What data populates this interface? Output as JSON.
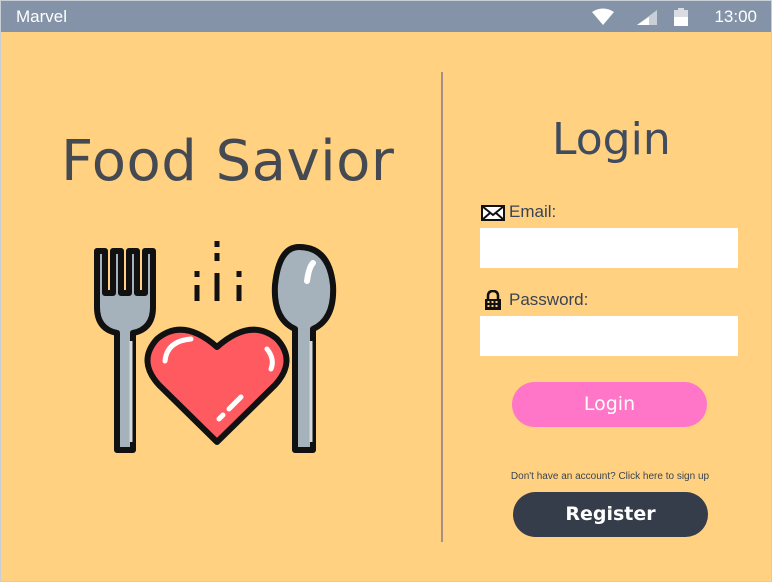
{
  "status_bar": {
    "app_name": "Marvel",
    "time": "13:00",
    "icons": [
      "wifi-icon",
      "signal-icon",
      "battery-icon"
    ]
  },
  "brand": {
    "title": "Food Savior",
    "logo_icon": "fork-heart-spoon-icon"
  },
  "login": {
    "heading": "Login",
    "email_label": "Email:",
    "email_icon": "envelope-icon",
    "email_value": "",
    "email_placeholder": "",
    "password_label": "Password:",
    "password_icon": "lock-icon",
    "password_value": "",
    "password_placeholder": "",
    "login_button": "Login",
    "signup_hint": "Don't have an account? Click here to sign up",
    "register_button": "Register"
  },
  "colors": {
    "background": "#ffd180",
    "status_bar": "#8493a8",
    "login_button": "#ff75c8",
    "register_button": "#353d4a",
    "heading_text": "#3f4b5f"
  }
}
